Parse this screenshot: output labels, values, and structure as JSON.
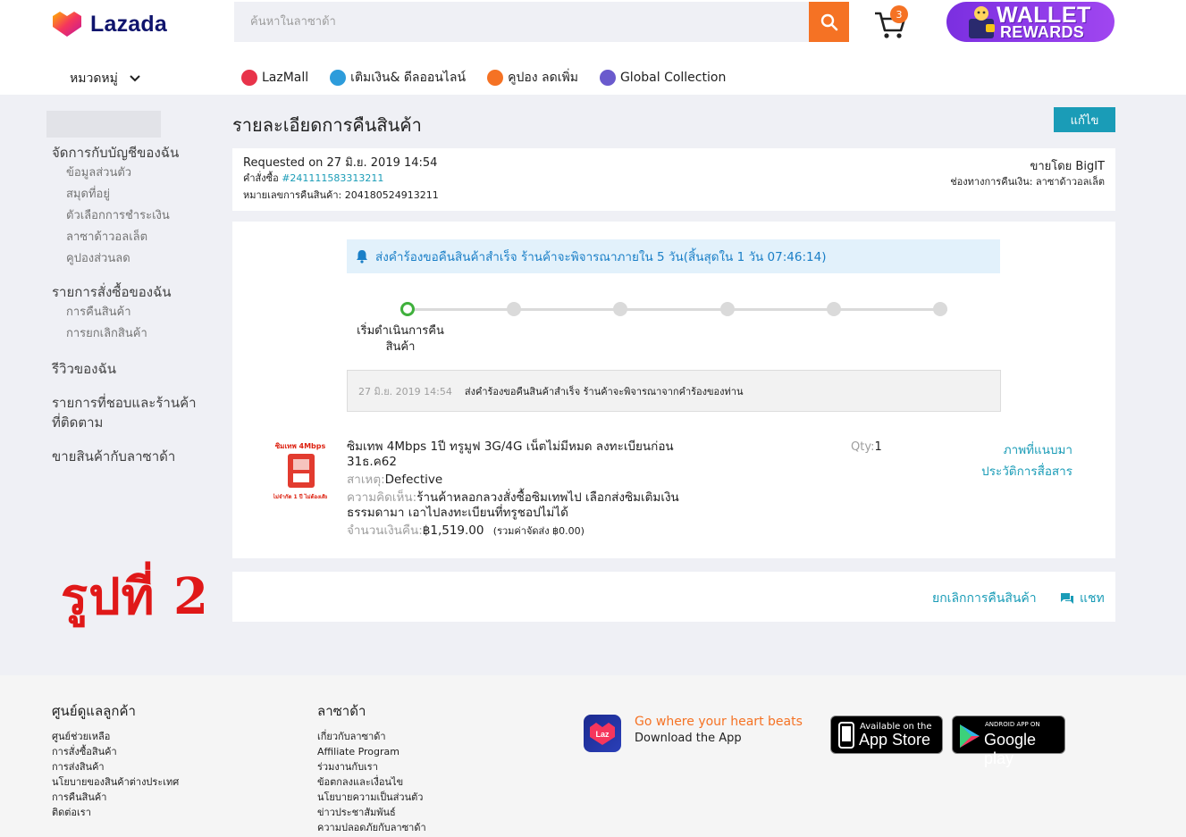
{
  "header": {
    "logo_text": "Lazada",
    "search_placeholder": "ค้นหาในลาซาด้า",
    "cart_count": "3",
    "wallet_line1": "WALLET",
    "wallet_line2": "REWARDS",
    "category_label": "หมวดหมู่",
    "quicklinks": [
      {
        "label": "LazMall",
        "icon": "lazmall-icon",
        "color": "#e8334a"
      },
      {
        "label": "เติมเงิน& ดีลออนไลน์",
        "icon": "topup-icon",
        "color": "#2d9cdb"
      },
      {
        "label": "คูปอง ลดเพิ่ม",
        "icon": "voucher-icon",
        "color": "#f57224"
      },
      {
        "label": "Global Collection",
        "icon": "global-icon",
        "color": "#6a5acd"
      }
    ]
  },
  "sidebar": {
    "sections": [
      {
        "title": "จัดการกับบัญชีของฉัน",
        "items": [
          "ข้อมูลส่วนตัว",
          "สมุดที่อยู่",
          "ตัวเลือกการชำระเงิน",
          "ลาซาด้าวอลเล็ต",
          "คูปองส่วนลด"
        ]
      },
      {
        "title": "รายการสั่งซื้อของฉัน",
        "items": [
          "การคืนสินค้า",
          "การยกเลิกสินค้า"
        ]
      },
      {
        "title": "รีวิวของฉัน",
        "items": []
      },
      {
        "title": "รายการที่ชอบและร้านค้าที่ติดตาม",
        "items": []
      },
      {
        "title": "ขายสินค้ากับลาซาด้า",
        "items": []
      }
    ]
  },
  "page": {
    "title": "รายละเอียดการคืนสินค้า",
    "edit_label": "แก้ไข"
  },
  "info": {
    "requested": "Requested on 27 มิ.ย. 2019 14:54",
    "order_label": "คำสั่งซื้อ ",
    "order_number": "#241111583313211",
    "return_number": "หมายเลขการคืนสินค้า: 204180524913211",
    "seller": "ขายโดย BigIT",
    "refund_channel": "ช่องทางการคืนเงิน: ลาซาด้าวอลเล็ต"
  },
  "status": {
    "notice": "ส่งคำร้องขอคืนสินค้าสำเร็จ ร้านค้าจะพิจารณาภายใน 5 วัน(สิ้นสุดใน 1 วัน 07:46:14)",
    "step_label": "เริ่มดำเนินการคืนสินค้า",
    "step_count": 6,
    "active_step": 0,
    "history_time": "27 มิ.ย. 2019 14:54",
    "history_text": "ส่งคำร้องขอคืนสินค้าสำเร็จ ร้านค้าจะพิจารณาจากคำร้องของท่าน"
  },
  "product": {
    "image_top_text": "ซิมเทพ 4Mbps",
    "image_bottom_text": "เน็ตไม่จำกัด 1 ปี ไม่ต้องเติมเงิน",
    "name": "ซิมเทพ 4Mbps 1ปี ทรูมูฟ 3G/4G เน็ตไม่มีหมด ลงทะเบียนก่อน 31ธ.ค62",
    "reason_label": "สาเหตุ:",
    "reason": "Defective",
    "comment_label": "ความคิดเห็น:",
    "comment": "ร้านค้าหลอกลวงสั่งซื้อซิมเทพไป เลือกส่งซิมเติมเงินธรรมดามา เอาไปลงทะเบียนที่ทรูชอปไม่ได้",
    "amount_label": "จำนวนเงินคืน:",
    "amount": "฿1,519.00",
    "shipping_note": "(รวมค่าจัดส่ง ฿0.00)",
    "qty_label": "Qty:",
    "qty": "1",
    "attached_images": "ภาพที่แนบมา",
    "communication_history": "ประวัติการสื่อสาร"
  },
  "actions": {
    "cancel_return": "ยกเลิกการคืนสินค้า",
    "chat": "แชท"
  },
  "watermark": "รูปที่ 2",
  "footer": {
    "col1": {
      "title": "ศูนย์ดูแลลูกค้า",
      "links": [
        "ศูนย์ช่วยเหลือ",
        "การสั่งซื้อสินค้า",
        "การส่งสินค้า",
        "นโยบายของสินค้าต่างประเทศ",
        "การคืนสินค้า",
        "ติดต่อเรา"
      ]
    },
    "col2": {
      "title": "ลาซาด้า",
      "links": [
        "เกี่ยวกับลาซาด้า",
        "Affiliate Program",
        "ร่วมงานกับเรา",
        "ข้อตกลงและเงื่อนไข",
        "นโยบายความเป็นส่วนตัว",
        "ข่าวประชาสัมพันธ์",
        "ความปลอดภัยกับลาซาด้า"
      ]
    },
    "app_icon_text": "Laz",
    "app_tagline": "Go where your heart beats",
    "app_download": "Download the App",
    "appstore_small": "Available on the",
    "appstore_big": "App Store",
    "gplay_small": "ANDROID APP ON",
    "gplay_big": "Google play"
  },
  "colors": {
    "accent": "#f57224",
    "teal": "#1a9cb7",
    "wallet": "#8a3ae6",
    "success": "#3fb03c"
  }
}
